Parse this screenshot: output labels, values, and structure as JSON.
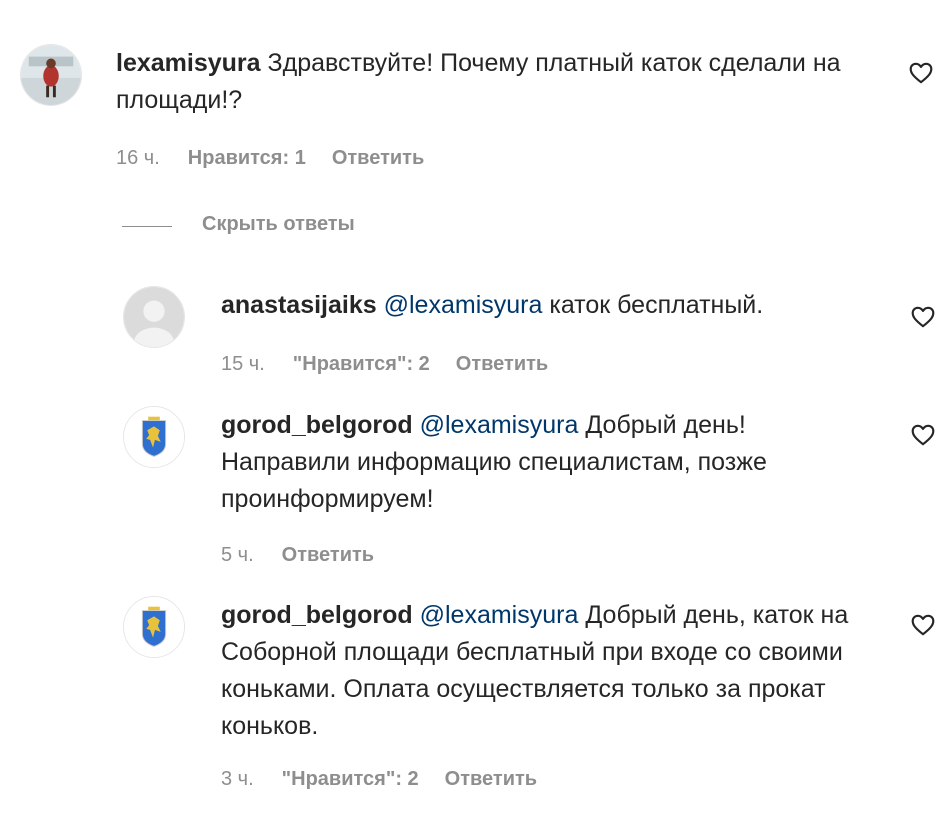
{
  "comment": {
    "username": "lexamisyura",
    "text": "Здравствуйте! Почему платный каток сделали на площади!?",
    "time": "16 ч.",
    "likes": "Нравится: 1",
    "reply": "Ответить",
    "like_icon": "heart-outline-icon"
  },
  "hide_replies_label": "Скрыть ответы",
  "replies": [
    {
      "username": "anastasijaiks",
      "mention": "@lexamisyura",
      "text": "каток бесплатный.",
      "time": "15 ч.",
      "likes": "\"Нравится\": 2",
      "reply": "Ответить"
    },
    {
      "username": "gorod_belgorod",
      "mention": "@lexamisyura",
      "text": "Добрый день! Направили информацию специалистам, позже проинформируем!",
      "time": "5 ч.",
      "reply": "Ответить"
    },
    {
      "username": "gorod_belgorod",
      "mention": "@lexamisyura",
      "text": "Добрый день, каток на Соборной площади бесплатный при входе со своими коньками. Оплата осуществляется только за прокат коньков.",
      "time": "3 ч.",
      "likes": "\"Нравится\": 2",
      "reply": "Ответить"
    }
  ],
  "colors": {
    "text": "#262626",
    "secondary": "#8e8e8e",
    "mention": "#00376b",
    "coat_blue": "#2f6fcf",
    "coat_gold": "#e8c23a"
  }
}
